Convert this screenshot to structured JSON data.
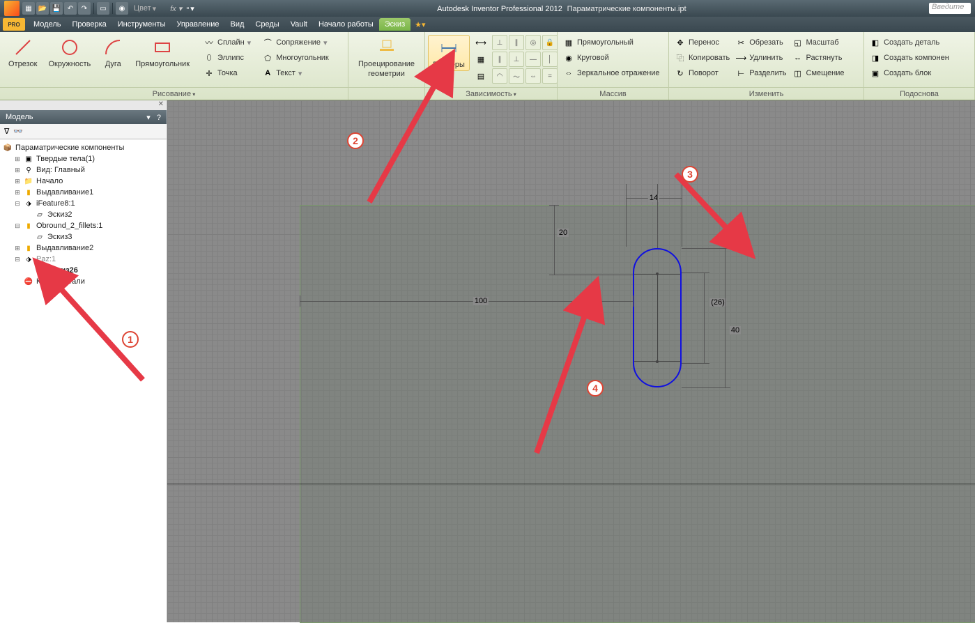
{
  "titlebar": {
    "app_title": "Autodesk Inventor Professional 2012",
    "file_name": "Параматрические компоненты.ipt",
    "color_label": "Цвет",
    "fx_label": "fx",
    "search_placeholder": "Введите"
  },
  "menu": {
    "pro": "PRO",
    "items": [
      "Модель",
      "Проверка",
      "Инструменты",
      "Управление",
      "Вид",
      "Среды",
      "Vault",
      "Начало работы",
      "Эскиз"
    ],
    "active_index": 8
  },
  "ribbon": {
    "panels": {
      "draw": {
        "title": "Рисование",
        "big": [
          {
            "name": "line",
            "label": "Отрезок"
          },
          {
            "name": "circle",
            "label": "Окружность"
          },
          {
            "name": "arc",
            "label": "Дуга"
          },
          {
            "name": "rect",
            "label": "Прямоугольник"
          }
        ],
        "small": [
          {
            "name": "spline",
            "label": "Сплайн"
          },
          {
            "name": "ellipse",
            "label": "Эллипс"
          },
          {
            "name": "point",
            "label": "Точка"
          },
          {
            "name": "fillet",
            "label": "Сопряжение"
          },
          {
            "name": "polygon",
            "label": "Многоугольник"
          },
          {
            "name": "text",
            "label": "Текст"
          }
        ]
      },
      "project": {
        "title": "",
        "label1": "Проецирование",
        "label2": "геометрии"
      },
      "dimension": {
        "title": "",
        "label": "Размеры"
      },
      "constraint": {
        "title": "Зависимость"
      },
      "pattern": {
        "title": "Массив",
        "items": [
          {
            "name": "rectangular",
            "label": "Прямоугольный"
          },
          {
            "name": "circular",
            "label": "Круговой"
          },
          {
            "name": "mirror",
            "label": "Зеркальное отражение"
          }
        ]
      },
      "modify": {
        "title": "Изменить",
        "items": [
          {
            "name": "move",
            "label": "Перенос"
          },
          {
            "name": "copy",
            "label": "Копировать"
          },
          {
            "name": "rotate",
            "label": "Поворот"
          },
          {
            "name": "trim",
            "label": "Обрезать"
          },
          {
            "name": "extend",
            "label": "Удлинить"
          },
          {
            "name": "split",
            "label": "Разделить"
          },
          {
            "name": "scale",
            "label": "Масштаб"
          },
          {
            "name": "stretch",
            "label": "Растянуть"
          },
          {
            "name": "offset",
            "label": "Смещение"
          }
        ]
      },
      "create": {
        "title": "Подоснова",
        "items": [
          {
            "name": "make-part",
            "label": "Создать деталь"
          },
          {
            "name": "make-comp",
            "label": "Создать компонен"
          },
          {
            "name": "make-block",
            "label": "Создать блок"
          }
        ]
      }
    }
  },
  "sidebar": {
    "title": "Модель",
    "root": "Параматрические компоненты",
    "items": [
      {
        "label": "Твердые тела(1)",
        "icon": "solids",
        "indent": 1,
        "exp": "+"
      },
      {
        "label": "Вид: Главный",
        "icon": "view",
        "indent": 1,
        "exp": "+",
        "gray": false
      },
      {
        "label": "Начало",
        "icon": "origin",
        "indent": 1,
        "exp": "+"
      },
      {
        "label": "Выдавливание1",
        "icon": "extrude",
        "indent": 1,
        "exp": "+"
      },
      {
        "label": "iFeature8:1",
        "icon": "ifeature",
        "indent": 1,
        "exp": "-"
      },
      {
        "label": "Эскиз2",
        "icon": "sketch",
        "indent": 2
      },
      {
        "label": "Obround_2_fillets:1",
        "icon": "ifeature",
        "indent": 1,
        "exp": "-"
      },
      {
        "label": "Эскиз3",
        "icon": "sketch",
        "indent": 2
      },
      {
        "label": "Выдавливание2",
        "icon": "extrude",
        "indent": 1,
        "exp": "+"
      },
      {
        "label": "Paz:1",
        "icon": "ifeature",
        "indent": 1,
        "exp": "-",
        "gray": true
      },
      {
        "label": "Эскиз26",
        "icon": "sketch",
        "indent": 2,
        "bold": true
      },
      {
        "label": "Конец детали",
        "icon": "end",
        "indent": 1
      }
    ]
  },
  "dimensions": {
    "width_100": "100",
    "d14": "14",
    "d20": "20",
    "d26": "(26)",
    "d40": "40"
  },
  "annotations": {
    "n1": "1",
    "n2": "2",
    "n3": "3",
    "n4": "4"
  }
}
